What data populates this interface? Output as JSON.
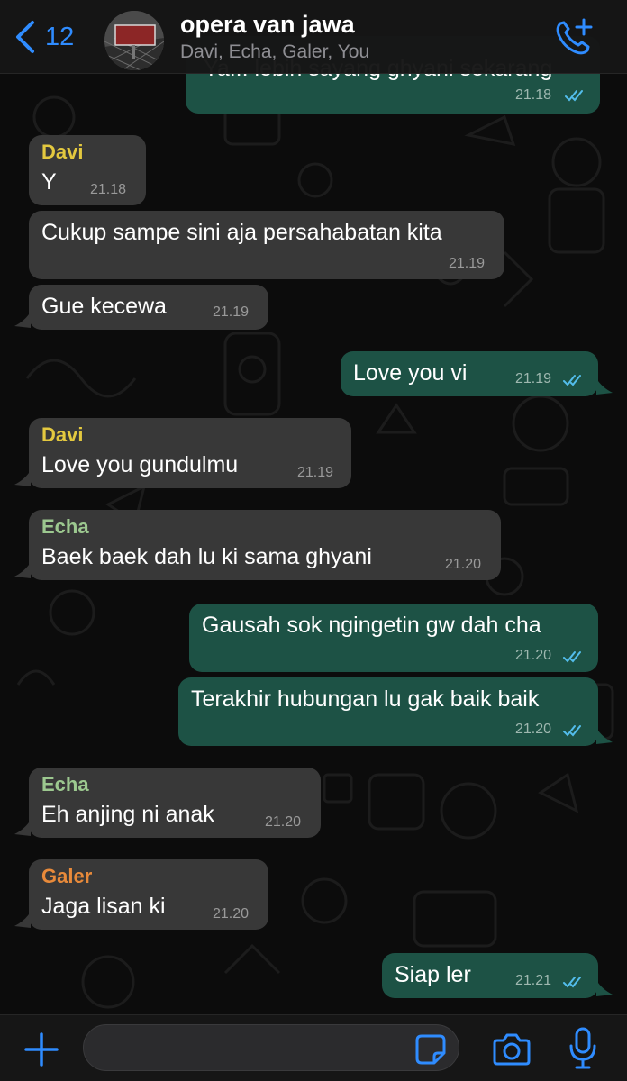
{
  "header": {
    "back_count": "12",
    "title": "opera van jawa",
    "members": "Davi, Echa, Galer, You",
    "avatar_sign_text": "OPERA VAN JAWA"
  },
  "colors": {
    "accent": "#2f8cff",
    "outgoing_bubble": "#1d5245",
    "incoming_bubble": "#383838",
    "sender_davi": "#e3c83f",
    "sender_echa": "#9cc88f",
    "sender_galer": "#e88a3a",
    "read_ticks": "#53bdeb"
  },
  "messages": [
    {
      "direction": "out",
      "sender": "",
      "text": "Ya... lebih sayang ghyani sekarang",
      "time": "21.18",
      "read": true
    },
    {
      "direction": "in",
      "sender": "Davi",
      "text": "Y",
      "time": "21.18"
    },
    {
      "direction": "in",
      "sender": "",
      "text": "Cukup sampe sini aja persahabatan kita",
      "time": "21.19"
    },
    {
      "direction": "in",
      "sender": "",
      "text": "Gue kecewa",
      "time": "21.19"
    },
    {
      "direction": "out",
      "sender": "",
      "text": "Love you vi",
      "time": "21.19",
      "read": true
    },
    {
      "direction": "in",
      "sender": "Davi",
      "text": "Love you gundulmu",
      "time": "21.19"
    },
    {
      "direction": "in",
      "sender": "Echa",
      "text": "Baek baek dah lu ki sama ghyani",
      "time": "21.20"
    },
    {
      "direction": "out",
      "sender": "",
      "text": "Gausah sok ngingetin gw dah cha",
      "time": "21.20",
      "read": true
    },
    {
      "direction": "out",
      "sender": "",
      "text": "Terakhir hubungan lu gak baik baik",
      "time": "21.20",
      "read": true
    },
    {
      "direction": "in",
      "sender": "Echa",
      "text": "Eh anjing ni anak",
      "time": "21.20"
    },
    {
      "direction": "in",
      "sender": "Galer",
      "text": "Jaga lisan ki",
      "time": "21.20"
    },
    {
      "direction": "out",
      "sender": "",
      "text": "Siap ler",
      "time": "21.21",
      "read": true
    }
  ],
  "composer": {
    "placeholder": ""
  },
  "icons": {
    "back": "chevron-left-icon",
    "call": "phone-plus-icon",
    "add": "plus-icon",
    "sticker": "sticker-icon",
    "camera": "camera-icon",
    "mic": "microphone-icon"
  }
}
